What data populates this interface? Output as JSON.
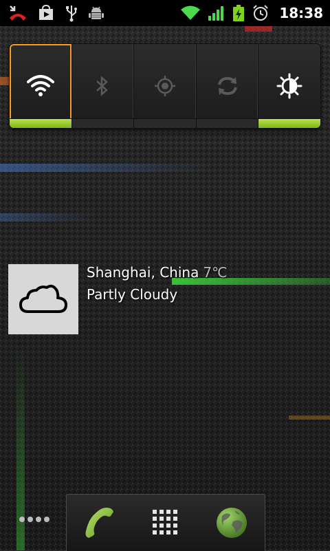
{
  "status_bar": {
    "time": "18:38",
    "left_icons": [
      "missed-call-icon",
      "play-store-icon",
      "usb-icon",
      "android-debug-icon"
    ],
    "right_icons": [
      "wifi-icon",
      "signal-icon",
      "battery-charging-icon",
      "alarm-icon"
    ]
  },
  "power_control": {
    "buttons": [
      {
        "name": "wifi",
        "icon": "wifi-icon",
        "on": true,
        "selected": true
      },
      {
        "name": "bluetooth",
        "icon": "bluetooth-icon",
        "on": false
      },
      {
        "name": "gps",
        "icon": "gps-icon",
        "on": false
      },
      {
        "name": "sync",
        "icon": "sync-icon",
        "on": false
      },
      {
        "name": "brightness",
        "icon": "brightness-icon",
        "on": true
      }
    ]
  },
  "weather": {
    "location": "Shanghai, China",
    "temperature": "7℃",
    "condition": "Partly Cloudy",
    "icon": "cloud-icon"
  },
  "dock": {
    "items": [
      {
        "name": "phone",
        "icon": "phone-icon"
      },
      {
        "name": "app-drawer",
        "icon": "app-grid-icon"
      },
      {
        "name": "browser",
        "icon": "globe-icon"
      }
    ],
    "page_indicator_dots": 4
  },
  "colors": {
    "accent_orange": "#ff9a1a",
    "indicator_green": "#9dd12f",
    "status_green": "#4cd94c"
  }
}
